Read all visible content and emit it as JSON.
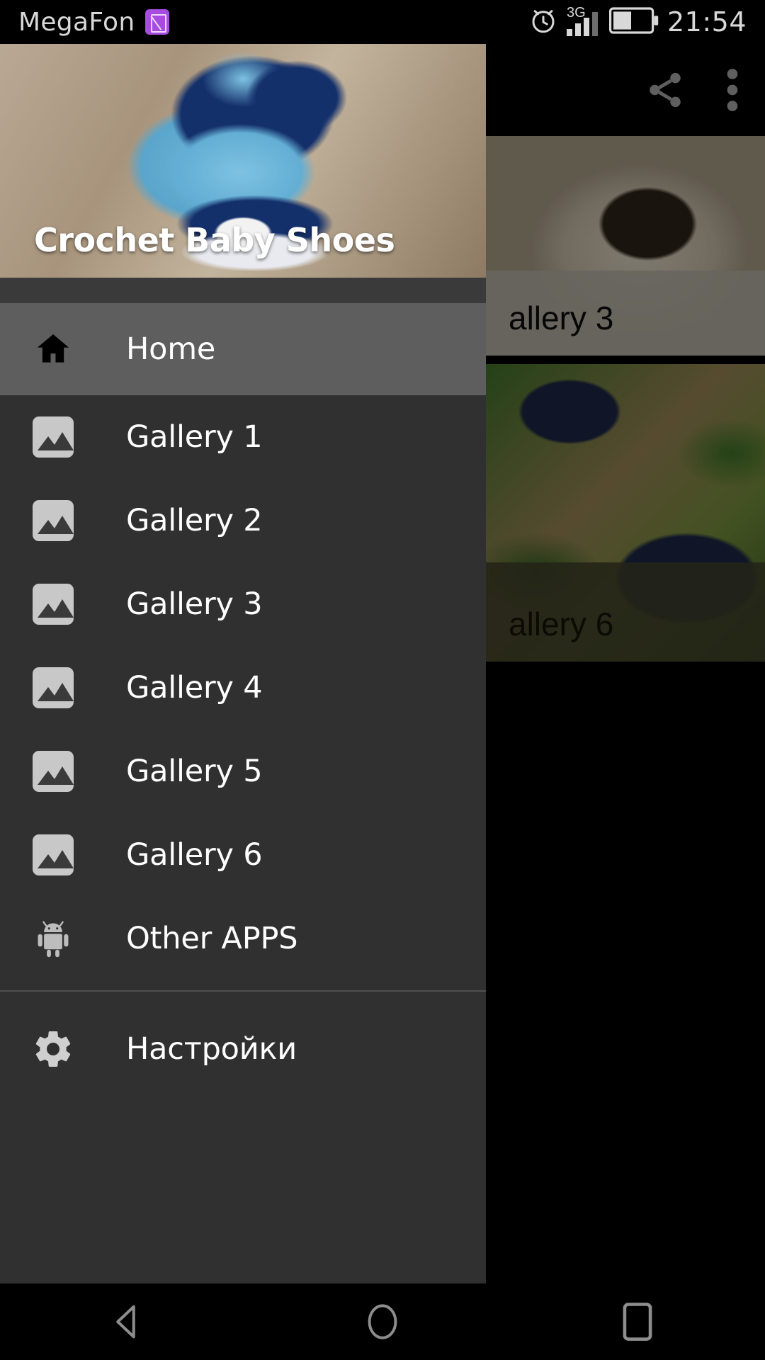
{
  "status_bar": {
    "carrier": "MegaFon",
    "sim_badge_icon": "sim-card-icon",
    "alarm_icon": "alarm-clock-icon",
    "network_type": "3G",
    "signal_icon": "signal-bars-icon",
    "battery_icon": "battery-half-icon",
    "clock": "21:54"
  },
  "toolbar": {
    "share_icon": "share-icon",
    "overflow_icon": "overflow-menu-icon"
  },
  "drawer": {
    "header": {
      "title": "Crochet Baby Shoes",
      "image_alt": "blue-crochet-baby-boot-photo"
    },
    "items": [
      {
        "label": "Home",
        "icon": "home-icon",
        "selected": true
      },
      {
        "label": "Gallery 1",
        "icon": "image-icon",
        "selected": false
      },
      {
        "label": "Gallery 2",
        "icon": "image-icon",
        "selected": false
      },
      {
        "label": "Gallery 3",
        "icon": "image-icon",
        "selected": false
      },
      {
        "label": "Gallery 4",
        "icon": "image-icon",
        "selected": false
      },
      {
        "label": "Gallery 5",
        "icon": "image-icon",
        "selected": false
      },
      {
        "label": "Gallery 6",
        "icon": "image-icon",
        "selected": false
      },
      {
        "label": "Other APPS",
        "icon": "android-icon",
        "selected": false
      }
    ],
    "settings": {
      "label": "Настройки",
      "icon": "gear-icon"
    }
  },
  "content": {
    "cards": [
      {
        "caption": "allery 3",
        "image_alt": "cream-crochet-slipper-photo"
      },
      {
        "caption": "allery 6",
        "image_alt": "navy-crochet-shoes-on-leaves-photo"
      }
    ]
  },
  "navbar": {
    "back": "back-icon",
    "home": "home-circle-icon",
    "recents": "recents-icon"
  },
  "colors": {
    "drawer_bg": "#303030",
    "drawer_selected": "#5e5e5e",
    "status_bar_bg": "#000000",
    "text_primary": "#ffffff",
    "icon_gray": "#c8c8c8",
    "sim_badge": "#a64ce0"
  }
}
